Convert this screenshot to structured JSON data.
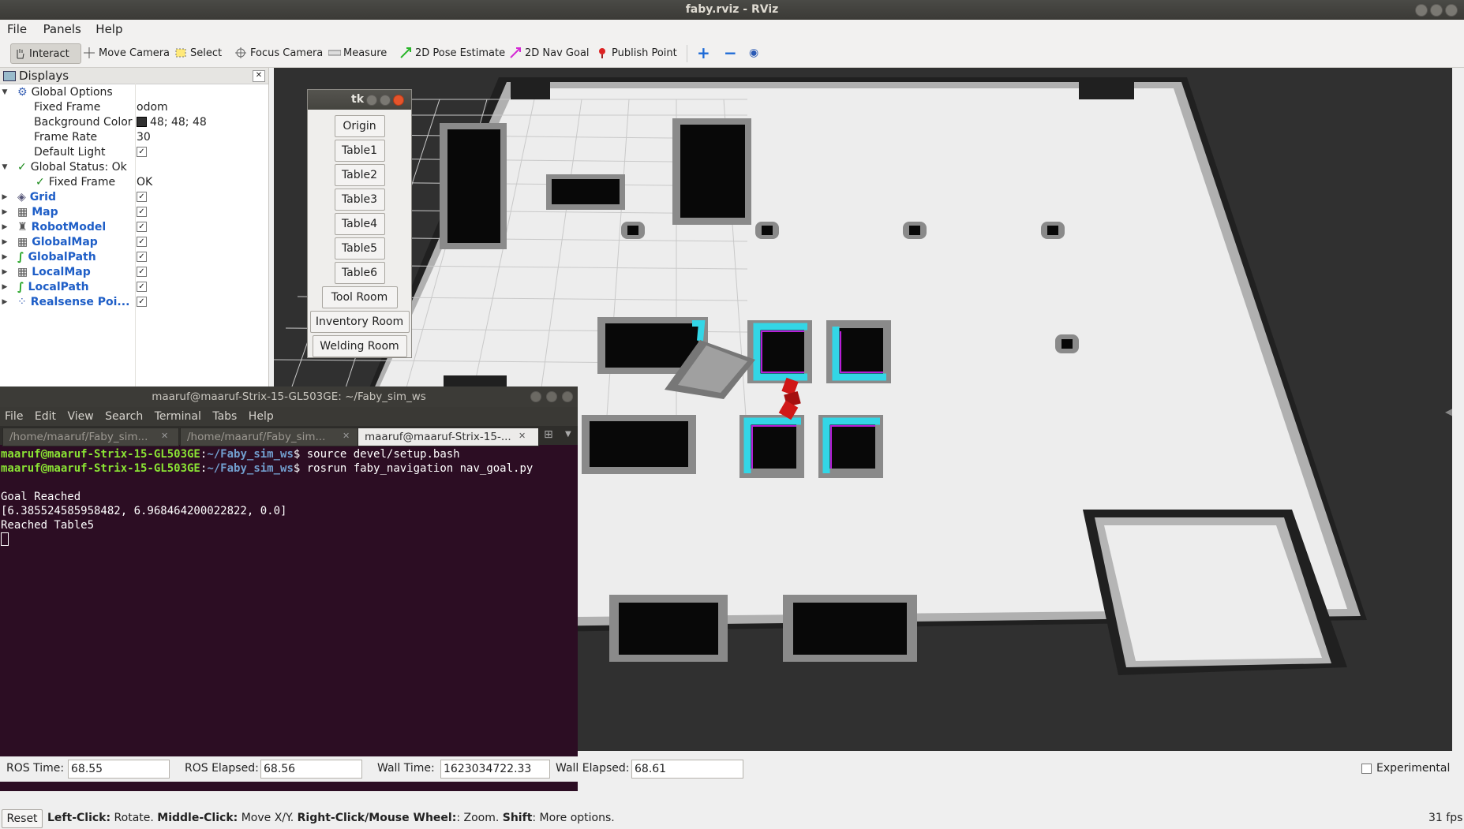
{
  "window": {
    "title": "faby.rviz - RViz"
  },
  "menu": [
    "File",
    "Panels",
    "Help"
  ],
  "toolbar": {
    "tools": [
      {
        "label": "Interact",
        "icon": "hand-icon",
        "active": true
      },
      {
        "label": "Move Camera",
        "icon": "move-camera-icon"
      },
      {
        "label": "Select",
        "icon": "select-icon"
      },
      {
        "label": "Focus Camera",
        "icon": "focus-camera-icon"
      },
      {
        "label": "Measure",
        "icon": "ruler-icon"
      },
      {
        "label": "2D Pose Estimate",
        "icon": "pose-arrow-icon"
      },
      {
        "label": "2D Nav Goal",
        "icon": "nav-goal-arrow-icon"
      },
      {
        "label": "Publish Point",
        "icon": "pin-icon"
      }
    ]
  },
  "displays": {
    "title": "Displays",
    "global_options": "Global Options",
    "fixed_frame_label": "Fixed Frame",
    "fixed_frame_value": "odom",
    "bg_color_label": "Background Color",
    "bg_color_value": "48; 48; 48",
    "frame_rate_label": "Frame Rate",
    "frame_rate_value": "30",
    "default_light_label": "Default Light",
    "global_status": "Global Status: Ok",
    "status_fixed_frame_label": "Fixed Frame",
    "status_fixed_frame_value": "OK",
    "items": [
      "Grid",
      "Map",
      "RobotModel",
      "GlobalMap",
      "GlobalPath",
      "LocalMap",
      "LocalPath",
      "Realsense Poi..."
    ]
  },
  "tk": {
    "title": "tk",
    "buttons": [
      "Origin",
      "Table1",
      "Table2",
      "Table3",
      "Table4",
      "Table5",
      "Table6",
      "Tool Room",
      "Inventory Room",
      "Welding Room"
    ]
  },
  "terminal": {
    "title": "maaruf@maaruf-Strix-15-GL503GE: ~/Faby_sim_ws",
    "menu": [
      "File",
      "Edit",
      "View",
      "Search",
      "Terminal",
      "Tabs",
      "Help"
    ],
    "tabs": [
      "/home/maaruf/Faby_sim...",
      "/home/maaruf/Faby_sim...",
      "maaruf@maaruf-Strix-15-..."
    ],
    "prompt_user": "maaruf@maaruf-Strix-15-GL503GE",
    "prompt_path": "~/Faby_sim_ws",
    "cmd1": "source devel/setup.bash",
    "cmd2": "rosrun faby_navigation nav_goal.py",
    "out1": "Goal Reached",
    "out2": "[6.385524585958482, 6.968464200022822, 0.0]",
    "out3": "Reached Table5"
  },
  "time": {
    "ros_time_label": "ROS Time:",
    "ros_time_value": "68.55",
    "ros_elapsed_label": "ROS Elapsed:",
    "ros_elapsed_value": "68.56",
    "wall_time_label": "Wall Time:",
    "wall_time_value": "1623034722.33",
    "wall_elapsed_label": "Wall Elapsed:",
    "wall_elapsed_value": "68.61",
    "experimental": "Experimental"
  },
  "status": {
    "reset": "Reset",
    "lc_b": "Left-Click:",
    "lc": " Rotate. ",
    "mc_b": "Middle-Click:",
    "mc": " Move X/Y. ",
    "rc_b": "Right-Click/Mouse Wheel:",
    "rc": ": Zoom. ",
    "sh_b": "Shift",
    "sh": ": More options.",
    "fps": "31 fps"
  },
  "colors": {
    "background": "#303030",
    "costmap": "#33d6e6",
    "path": "#b81ed6",
    "robot": "#d01818"
  }
}
